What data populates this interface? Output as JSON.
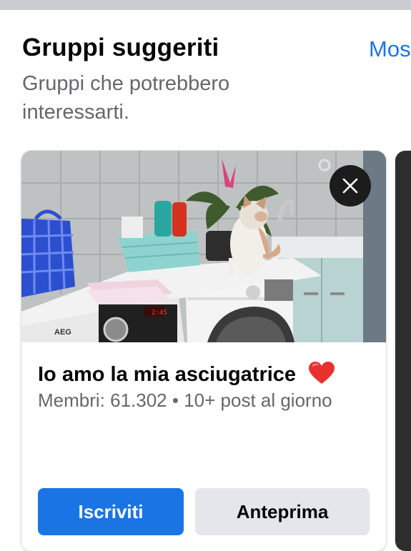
{
  "section": {
    "title": "Gruppi suggeriti",
    "see_all_label": "Mos",
    "subtitle": "Gruppi che potrebbero interessarti."
  },
  "card": {
    "group_name": "Io amo la mia asciugatrice",
    "meta": "Membri: 61.302 • 10+ post al giorno",
    "join_label": "Iscriviti",
    "preview_label": "Anteprima",
    "image_icon": "laundry-room-cat-photo",
    "close_icon": "close-icon",
    "heart_icon": "heart-icon",
    "washer_brand": "AEG"
  },
  "colors": {
    "accent": "#1b74e4",
    "secondary_text": "#65676b",
    "secondary_button": "#e4e6eb"
  }
}
